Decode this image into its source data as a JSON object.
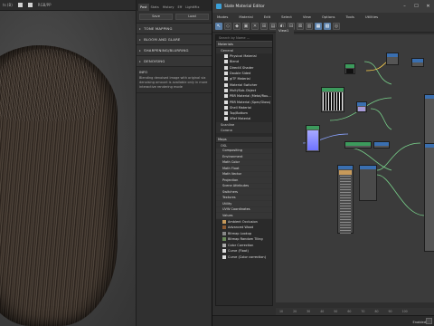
{
  "render": {
    "title_fragment": "ts (B)",
    "combo": "RGB/PP"
  },
  "settings": {
    "tabs": [
      "Post",
      "Stats",
      "History",
      "Eff",
      "LightMix"
    ],
    "buttons": [
      "Save",
      "Load"
    ],
    "sections": [
      "TONE MAPPING",
      "BLOOM AND GLARE",
      "SHARPENING/BLURRING",
      "DENOISING"
    ],
    "info_title": "INFO",
    "info_text": "Blending denoised image with original via denoising amount is available only in more interactive rendering mode"
  },
  "slate": {
    "title": "Slate Material Editor",
    "menu": [
      "Modes",
      "Material",
      "Edit",
      "Select",
      "View",
      "Options",
      "Tools",
      "Utilities"
    ],
    "view_tab": "View1",
    "search_placeholder": "Search by Name ...",
    "groups": [
      "Materials",
      "General",
      "Scanline",
      "Corona",
      "Maps",
      "OSL"
    ],
    "materials": [
      "Physical Material",
      "Blend",
      "DirectX Shader",
      "Double Sided",
      "glTF Material",
      "Material Switcher",
      "Multi/Sub-Object",
      "PBR Material (Metal/Rou...",
      "PBR Material (Spec/Gloss)",
      "Shell Material",
      "Top/Bottom",
      "XRef Material"
    ],
    "osl_items": [
      "Compositing",
      "Environment",
      "Math Color",
      "Math Float",
      "Math Vector",
      "Projection",
      "Scene Attributes",
      "Switchers",
      "Textures",
      "Utility",
      "UVW Coordinates",
      "Values"
    ],
    "map_items": [
      "Ambient Occlusion",
      "Advanced Wood",
      "Bitmap Lookup",
      "Bitmap Random Tiling",
      "Color Correction",
      "Curve (Float)",
      "Curve (Color correction)"
    ],
    "ruler": [
      "10",
      "20",
      "30",
      "40",
      "50",
      "60",
      "70",
      "80",
      "90",
      "100"
    ],
    "status": "Enabled"
  },
  "colors": {
    "accent": "#5a7fa8",
    "node_blue": "#3a6fb0",
    "node_green": "#3c9a5c",
    "node_violet": "#8a8fff"
  }
}
